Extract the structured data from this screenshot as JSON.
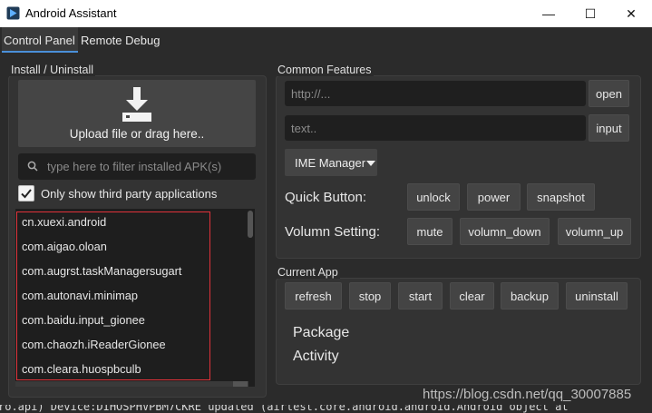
{
  "window": {
    "title": "Android Assistant",
    "minimize_glyph": "—",
    "maximize_glyph": "☐",
    "close_glyph": "✕"
  },
  "tabs": [
    {
      "label": "Control Panel",
      "active": true
    },
    {
      "label": "Remote Debug",
      "active": false
    }
  ],
  "install": {
    "group_title": "Install / Uninstall",
    "upload_label": "Upload file or drag here..",
    "filter_placeholder": "type here to filter installed APK(s)",
    "third_party_label": "Only show third party applications",
    "third_party_checked": true,
    "packages": [
      "cn.xuexi.android",
      "com.aigao.oloan",
      "com.augrst.taskManagersugart",
      "com.autonavi.minimap",
      "com.baidu.input_gionee",
      "com.chaozh.iReaderGionee",
      "com.cleara.huospbculb"
    ]
  },
  "common": {
    "group_title": "Common Features",
    "url_placeholder": "http://...",
    "open_label": "open",
    "text_placeholder": "text..",
    "input_label": "input",
    "ime_label": "IME Manager",
    "quick_label": "Quick Button:",
    "quick_buttons": [
      "unlock",
      "power",
      "snapshot"
    ],
    "volume_label": "Volumn Setting:",
    "volume_buttons": [
      "mute",
      "volumn_down",
      "volumn_up"
    ]
  },
  "current_app": {
    "group_title": "Current App",
    "buttons": [
      "refresh",
      "stop",
      "start",
      "clear",
      "backup",
      "uninstall"
    ],
    "package_label": "Package",
    "activity_label": "Activity"
  },
  "status_text": "ro.api) Device:DIHOSPHVPBM7CKRE updated (airtest.core.android.android.Android object at",
  "watermark": "https://blog.csdn.net/qq_30007885",
  "colors": {
    "accent": "#4a90d9",
    "selection_border": "#e0323a",
    "background": "#2b2b2b"
  }
}
